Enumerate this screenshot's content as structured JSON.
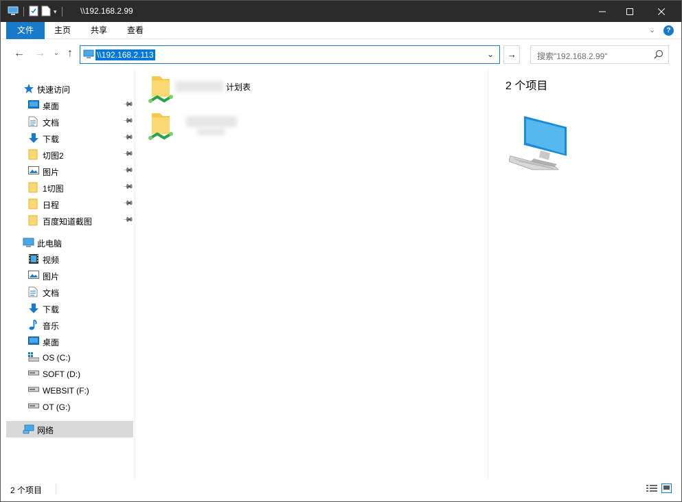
{
  "window": {
    "title": "\\\\192.168.2.99"
  },
  "ribbon": {
    "tabs": [
      {
        "label": "文件"
      },
      {
        "label": "主页"
      },
      {
        "label": "共享"
      },
      {
        "label": "查看"
      }
    ]
  },
  "address": {
    "path": "\\\\192.168.2.113"
  },
  "search": {
    "placeholder": "搜索\"192.168.2.99\""
  },
  "sidebar": {
    "quick_access": "快速访问",
    "quick_items": [
      {
        "label": "桌面",
        "icon": "desktop-icon"
      },
      {
        "label": "文档",
        "icon": "document-icon"
      },
      {
        "label": "下载",
        "icon": "download-icon"
      },
      {
        "label": "切图2",
        "icon": "folder-icon"
      },
      {
        "label": "图片",
        "icon": "picture-icon"
      },
      {
        "label": "1切图",
        "icon": "folder-icon"
      },
      {
        "label": "日程",
        "icon": "folder-icon"
      },
      {
        "label": "百度知道截图",
        "icon": "folder-icon"
      }
    ],
    "this_pc": "此电脑",
    "pc_items": [
      {
        "label": "视频",
        "icon": "video-icon"
      },
      {
        "label": "图片",
        "icon": "picture-icon"
      },
      {
        "label": "文档",
        "icon": "document-icon"
      },
      {
        "label": "下载",
        "icon": "download-icon"
      },
      {
        "label": "音乐",
        "icon": "music-icon"
      },
      {
        "label": "桌面",
        "icon": "desktop-icon"
      },
      {
        "label": "OS (C:)",
        "icon": "os-drive-icon"
      },
      {
        "label": "SOFT (D:)",
        "icon": "drive-icon"
      },
      {
        "label": "WEBSIT (F:)",
        "icon": "drive-icon"
      },
      {
        "label": "OT (G:)",
        "icon": "drive-icon"
      }
    ],
    "network": "网络"
  },
  "content": {
    "items": [
      {
        "label": "计划表",
        "icon": "shared-folder-icon"
      },
      {
        "label": "",
        "icon": "shared-folder-icon"
      }
    ]
  },
  "preview": {
    "count": "2 个项目"
  },
  "status": {
    "count": "2 个项目"
  },
  "colors": {
    "accent": "#1979ca",
    "titlebar": "#2b2b2b",
    "selection": "#0078d7"
  }
}
